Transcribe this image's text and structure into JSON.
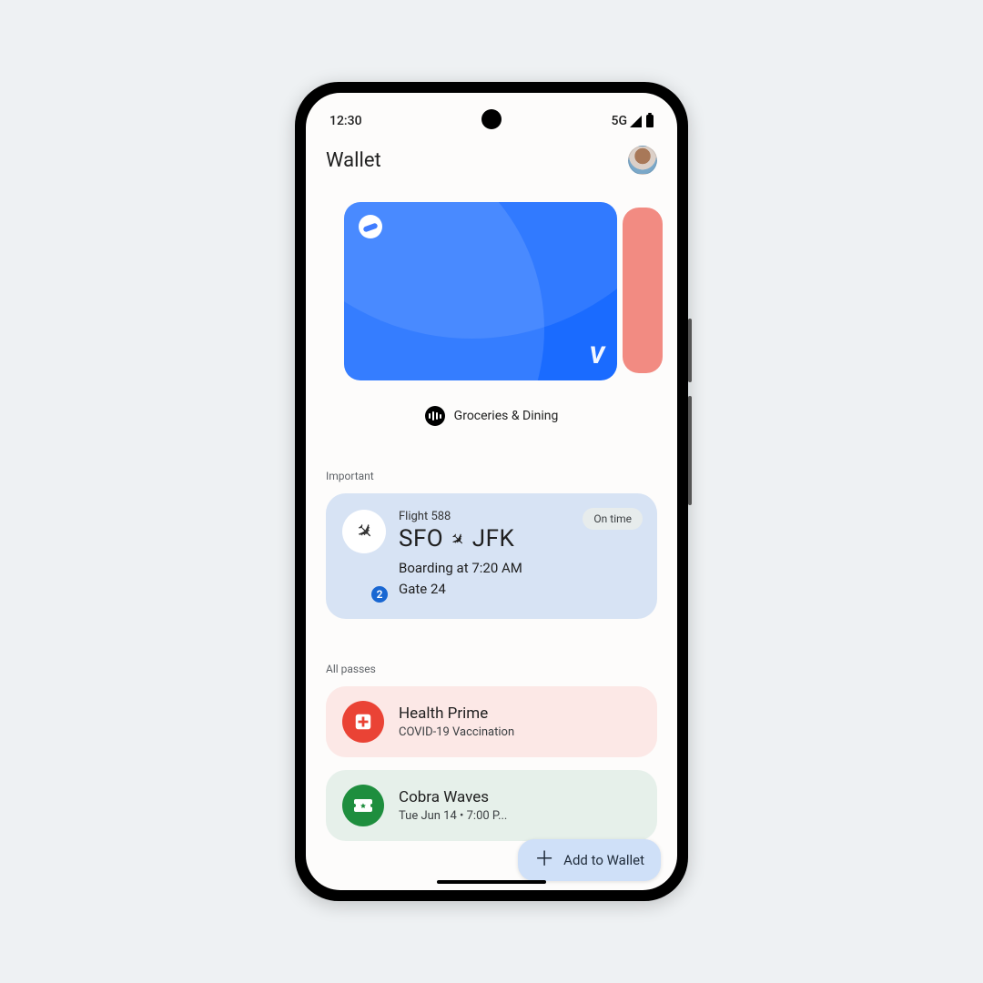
{
  "status": {
    "time": "12:30",
    "network": "5G"
  },
  "header": {
    "title": "Wallet"
  },
  "card": {
    "label": "Groceries & Dining"
  },
  "sections": {
    "important": "Important",
    "all_passes": "All passes"
  },
  "flight": {
    "number": "Flight 588",
    "from": "SFO",
    "to": "JFK",
    "boarding": "Boarding at 7:20 AM",
    "gate": "Gate 24",
    "status": "On time",
    "badge": "2"
  },
  "passes": [
    {
      "title": "Health Prime",
      "sub": "COVID-19 Vaccination"
    },
    {
      "title": "Cobra Waves",
      "sub": "Tue Jun 14 • 7:00 P..."
    }
  ],
  "fab": {
    "label": "Add to Wallet"
  }
}
